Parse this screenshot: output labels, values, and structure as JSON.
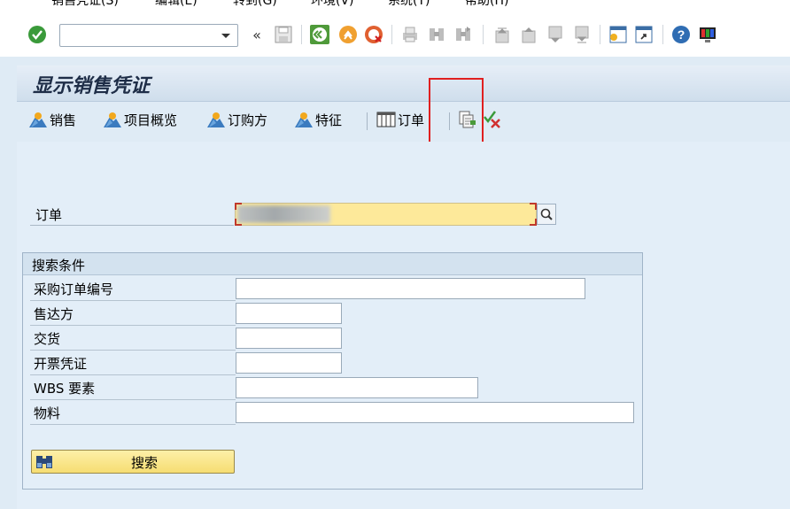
{
  "menu": {
    "items": [
      "销售凭证(S)",
      "编辑(E)",
      "转到(G)",
      "环境(V)",
      "系统(Y)",
      "帮助(H)"
    ]
  },
  "toolbar": {
    "command_field": ""
  },
  "title": "显示销售凭证",
  "app_toolbar": {
    "buttons": [
      "销售",
      "项目概览",
      "订购方",
      "特征",
      "订单"
    ]
  },
  "order": {
    "label": "订单",
    "value": ""
  },
  "search_group": {
    "title": "搜索条件",
    "fields": [
      {
        "label": "采购订单编号",
        "value": ""
      },
      {
        "label": "售达方",
        "value": ""
      },
      {
        "label": "交货",
        "value": ""
      },
      {
        "label": "开票凭证",
        "value": ""
      },
      {
        "label": "WBS 要素",
        "value": ""
      },
      {
        "label": "物料",
        "value": ""
      }
    ],
    "search_button": "搜索"
  },
  "colors": {
    "background": "#dfebf5",
    "title_text": "#1e2d47",
    "required_field": "#fde99a",
    "highlight_box": "#e02020"
  }
}
